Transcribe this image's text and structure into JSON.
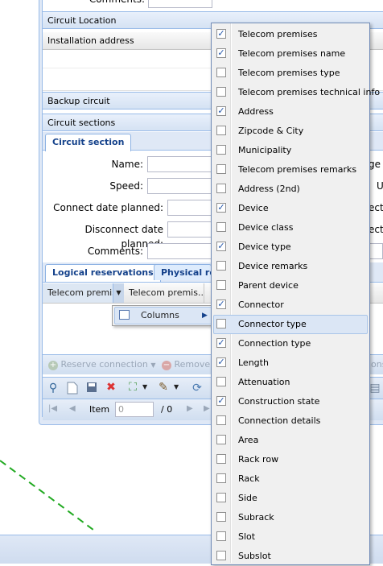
{
  "form": {
    "comments_top_label": "Comments:",
    "circuit_location": "Circuit Location",
    "installation_address": "Installation address",
    "backup_circuit": "Backup circuit",
    "circuit_sections": "Circuit sections",
    "circuit_section_tab": "Circuit section",
    "name_label": "Name:",
    "speed_label": "Speed:",
    "connect_planned_label": "Connect date planned:",
    "disconnect_planned_label": "Disconnect date planned:",
    "comments_label": "Comments:",
    "right_cut_1": "ge",
    "right_cut_2": "U",
    "right_cut_3": "ect",
    "right_cut_4": "ect"
  },
  "reservations": {
    "logical_tab": "Logical reservations",
    "physical_tab": "Physical res",
    "col1": "Telecom premise",
    "col2": "Telecom premis...",
    "columns_menu": "Columns"
  },
  "toolbar": {
    "reserve_connection": "Reserve connection",
    "remove": "Remove",
    "connections_cut": "ions"
  },
  "paging": {
    "item_label": "Item",
    "item_value": "0",
    "of_total": "/ 0"
  },
  "column_menu_items": [
    {
      "label": "Telecom premises",
      "checked": true
    },
    {
      "label": "Telecom premises name",
      "checked": true
    },
    {
      "label": "Telecom premises type",
      "checked": false
    },
    {
      "label": "Telecom premises technical info",
      "checked": false
    },
    {
      "label": "Address",
      "checked": true
    },
    {
      "label": "Zipcode & City",
      "checked": false
    },
    {
      "label": "Municipality",
      "checked": false
    },
    {
      "label": "Telecom premises remarks",
      "checked": false
    },
    {
      "label": "Address (2nd)",
      "checked": false
    },
    {
      "label": "Device",
      "checked": true
    },
    {
      "label": "Device class",
      "checked": false
    },
    {
      "label": "Device type",
      "checked": true
    },
    {
      "label": "Device remarks",
      "checked": false
    },
    {
      "label": "Parent device",
      "checked": false
    },
    {
      "label": "Connector",
      "checked": true
    },
    {
      "label": "Connector type",
      "checked": false,
      "hover": true
    },
    {
      "label": "Connection type",
      "checked": true
    },
    {
      "label": "Length",
      "checked": true
    },
    {
      "label": "Attenuation",
      "checked": false
    },
    {
      "label": "Construction state",
      "checked": true
    },
    {
      "label": "Connection details",
      "checked": false
    },
    {
      "label": "Area",
      "checked": false
    },
    {
      "label": "Rack row",
      "checked": false
    },
    {
      "label": "Rack",
      "checked": false
    },
    {
      "label": "Side",
      "checked": false
    },
    {
      "label": "Subrack",
      "checked": false
    },
    {
      "label": "Slot",
      "checked": false
    },
    {
      "label": "Subslot",
      "checked": false
    }
  ],
  "colors": {
    "header_blue": "#15428b",
    "border_blue": "#99bbe8",
    "menu_hover": "#dbe6f5",
    "dashed_line": "#22aa22"
  }
}
